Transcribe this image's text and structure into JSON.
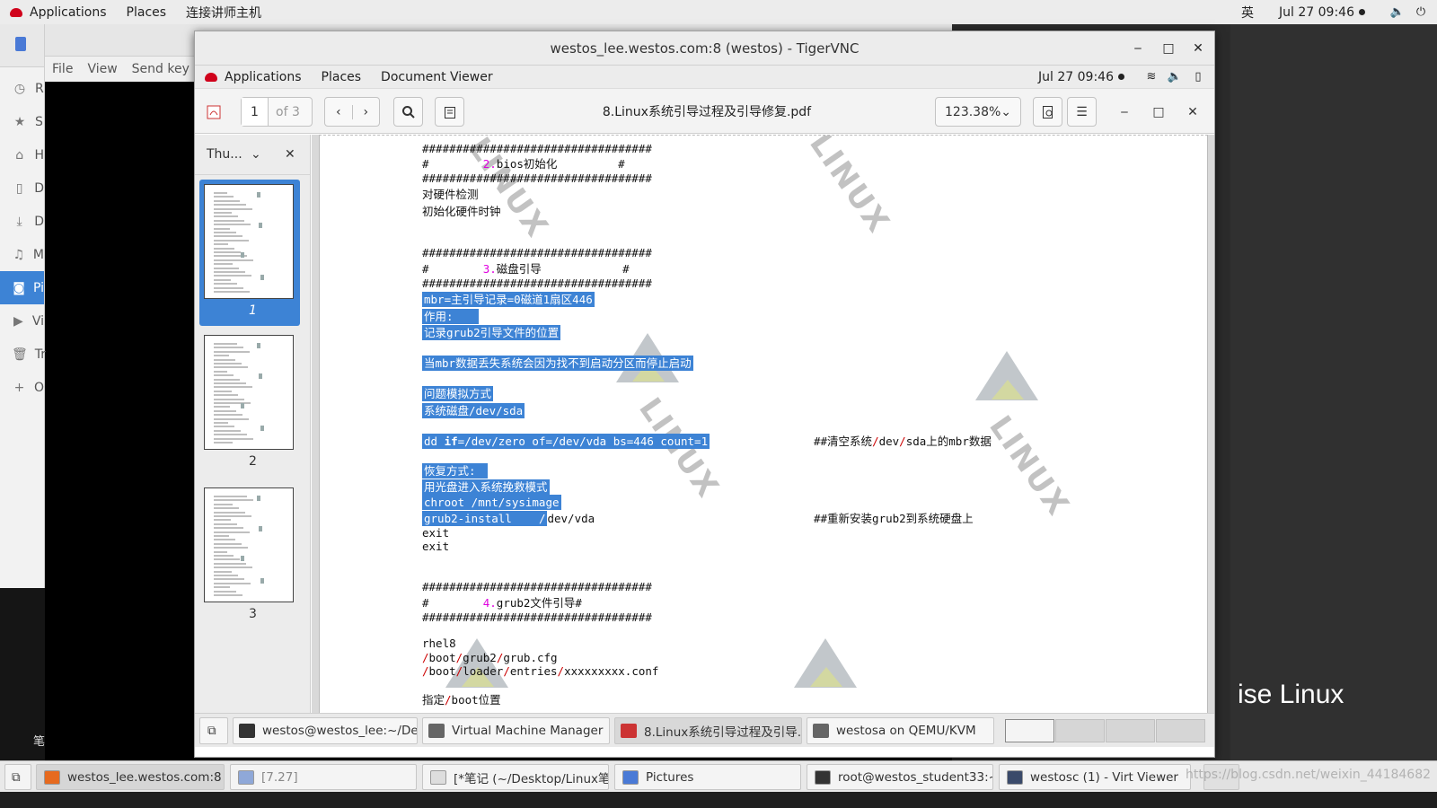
{
  "topbar": {
    "applications": "Applications",
    "places": "Places",
    "connect": "连接讲师主机",
    "ime": "英",
    "datetime": "Jul 27  09:46"
  },
  "files_sidebar": {
    "items": [
      {
        "icon": "clock-icon",
        "label": "R"
      },
      {
        "icon": "star-icon",
        "label": "S"
      },
      {
        "icon": "home-icon",
        "label": "H"
      },
      {
        "icon": "document-icon",
        "label": "D"
      },
      {
        "icon": "download-icon",
        "label": "D"
      },
      {
        "icon": "music-icon",
        "label": "M"
      },
      {
        "icon": "camera-icon",
        "label": "Pi"
      },
      {
        "icon": "video-icon",
        "label": "Vi"
      },
      {
        "icon": "trash-icon",
        "label": "Tr"
      },
      {
        "icon": "plus-icon",
        "label": "O"
      }
    ],
    "active_index": 6,
    "bottom_note": "笔"
  },
  "virt_menu": {
    "file": "File",
    "view": "View",
    "send_key": "Send key"
  },
  "desktop_watermark": "ise Linux",
  "vnc": {
    "title": "westos_lee.westos.com:8 (westos) - TigerVNC",
    "inner_top": {
      "applications": "Applications",
      "places": "Places",
      "app_name": "Document Viewer",
      "datetime": "Jul 27  09:46"
    },
    "viewer": {
      "page_input": "1",
      "page_of": "of 3",
      "doc_title": "8.Linux系统引导过程及引导修复.pdf",
      "zoom": "123.38%",
      "sidebar_label": "Thu...",
      "thumbs": [
        "1",
        "2",
        "3"
      ]
    },
    "doc": {
      "hash_line": "##################################",
      "s2": {
        "pre": "#        ",
        "num": "2.",
        "title": "bios初始化",
        "post": "         #"
      },
      "s2_lines": [
        "对硬件检测",
        "初始化硬件时钟"
      ],
      "s3": {
        "pre": "#        ",
        "num": "3.",
        "title": "磁盘引导",
        "post": "            #"
      },
      "s3_lines": [
        "mbr=主引导记录=0磁道1扇区446",
        "作用:",
        "记录grub2引导文件的位置",
        "当mbr数据丢失系统会因为找不到启动分区而停止启动",
        "问题模拟方式",
        "系统磁盘/dev/sda"
      ],
      "dd_cmd": {
        "a": "dd ",
        "b": "if",
        "c": "=/dev/zero of=/dev/vda bs=446 count=1"
      },
      "dd_comment": {
        "a": "##清空系统",
        "b": "/",
        "c": "dev",
        "d": "/",
        "e": "sda上的mbr数据"
      },
      "recover": [
        "恢复方式:",
        "用光盘进入系统挽救模式",
        "chroot /mnt/sysimage"
      ],
      "grub_install": {
        "a": "grub2-install    ",
        "b": "/",
        "c": "dev/vda"
      },
      "grub_comment": "##重新安装grub2到系统硬盘上",
      "exit1": "exit",
      "exit2": "exit",
      "s4": {
        "pre": "#        ",
        "num": "4.",
        "title": "grub2文件引导#"
      },
      "s4_lines": {
        "rhel": "rhel8"
      },
      "path1": {
        "a": "/",
        "b": "boot",
        "c": "/",
        "d": "grub2",
        "e": "/",
        "f": "grub.cfg"
      },
      "path2": {
        "a": "/",
        "b": "boot",
        "c": "/",
        "d": "loader",
        "e": "/",
        "f": "entries",
        "g": "/",
        "h": "xxxxxxxxx.conf"
      },
      "boot_pos": {
        "a": "指定",
        "b": "/",
        "c": "boot",
        "d": "位置"
      }
    },
    "inner_tasks": [
      {
        "icon": "terminal-icon",
        "label": "westos@westos_lee:~/Des..."
      },
      {
        "icon": "vmm-icon",
        "label": "Virtual Machine Manager"
      },
      {
        "icon": "pdf-icon",
        "label": "8.Linux系统引导过程及引导..."
      },
      {
        "icon": "vmm-icon",
        "label": "westosa on QEMU/KVM"
      }
    ]
  },
  "outer_tasks": [
    {
      "icon": "firefox-icon",
      "label": "westos_lee.westos.com:8 (..."
    },
    {
      "icon": "file-icon",
      "label": "[7.27]"
    },
    {
      "icon": "text-editor-icon",
      "label": "[*笔记 (~/Desktop/Linux笔..."
    },
    {
      "icon": "folder-icon",
      "label": "Pictures"
    },
    {
      "icon": "terminal-icon",
      "label": "root@westos_student33:~..."
    },
    {
      "icon": "monitor-icon",
      "label": "westosc (1) - Virt Viewer"
    }
  ],
  "csdn_watermark": "https://blog.csdn.net/weixin_44184682",
  "colors": {
    "selection": "#3d83d5",
    "number_accent": "#e000e0",
    "path_red": "#cc0000"
  }
}
